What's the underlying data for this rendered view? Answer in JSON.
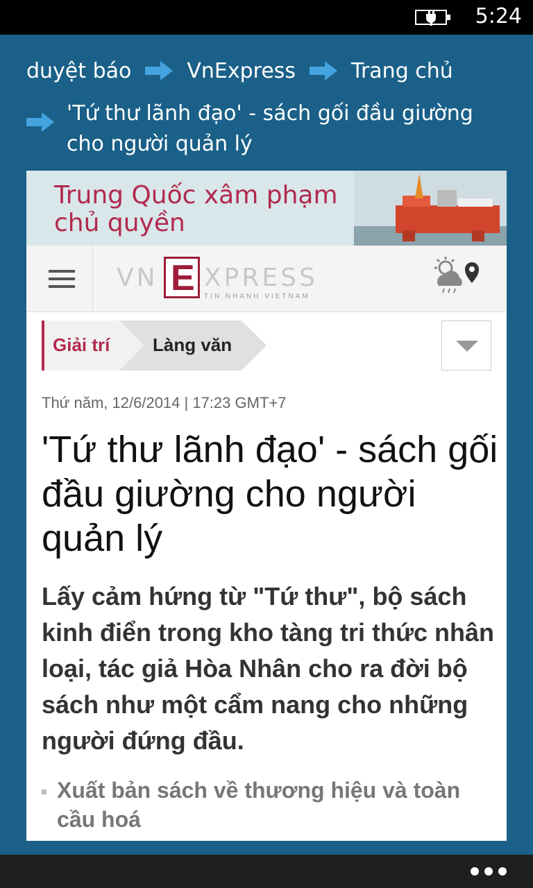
{
  "status_bar": {
    "time": "5:24",
    "icon": "battery-charging-icon"
  },
  "breadcrumb": {
    "items": [
      "duyệt báo",
      "VnExpress",
      "Trang chủ"
    ],
    "current_title": "'Tứ thư lãnh đạo' - sách gối đầu giường cho người quản lý",
    "separator_icon": "arrow-right-icon"
  },
  "banner": {
    "line1": "Trung Quốc xâm phạm",
    "line2": "chủ quyền"
  },
  "site_header": {
    "logo_left": "VN",
    "logo_mid": "E",
    "logo_right": "XPRESS",
    "logo_tagline": "TIN NHANH VIETNAM",
    "menu_icon": "hamburger-menu-icon",
    "weather_icon": "weather-location-icon"
  },
  "category": {
    "primary": "Giải trí",
    "secondary": "Làng văn",
    "dropdown_icon": "chevron-down-icon"
  },
  "article": {
    "dateline": "Thứ năm, 12/6/2014 | 17:23 GMT+7",
    "title": "'Tứ thư lãnh đạo' - sách gối đầu giường cho người quản lý",
    "lead": "Lấy cảm hứng từ \"Tứ thư\", bộ sách kinh điển trong kho tàng tri thức nhân loại, tác giả Hòa Nhân cho ra đời bộ sách như một cẩm nang cho những người đứng đầu.",
    "related": [
      "Xuất bản sách về thương hiệu và toàn cầu hoá"
    ]
  },
  "app_bar": {
    "more_icon": "more-dots-icon"
  },
  "colors": {
    "app_background": "#1a6088",
    "accent_red": "#b2294d",
    "arrow_blue": "#45a3e0"
  }
}
